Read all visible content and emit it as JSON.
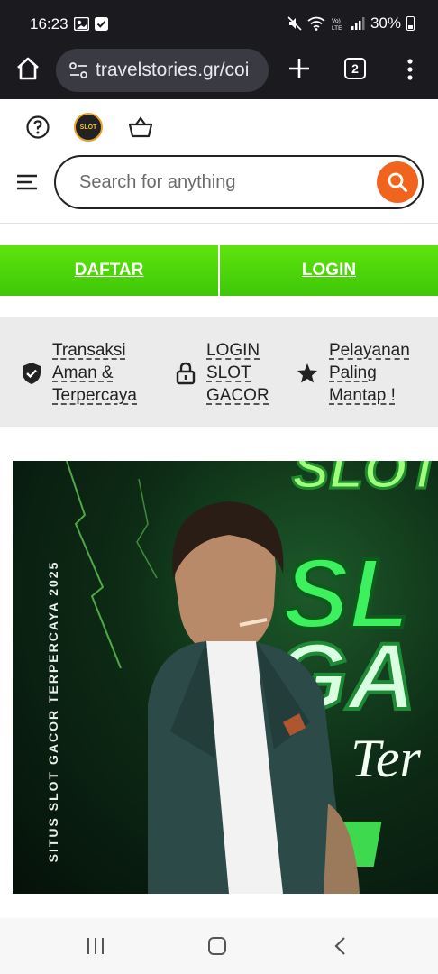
{
  "status_bar": {
    "time": "16:23",
    "battery": "30%",
    "left_icons": [
      "gallery-notification-icon",
      "check-notification-icon"
    ],
    "right_icons": [
      "mute-icon",
      "wifi-icon",
      "volte-icon",
      "signal-icon",
      "battery-icon"
    ]
  },
  "browser": {
    "url": "travelstories.gr/coi",
    "tab_count": "2",
    "icons": [
      "home-icon",
      "site-settings-icon",
      "new-tab-icon",
      "tab-switcher-icon",
      "more-menu-icon"
    ]
  },
  "site_header": {
    "logo_text": "SLOT",
    "search_placeholder": "Search for anything",
    "icons": [
      "help-icon",
      "basket-icon",
      "hamburger-menu-icon",
      "search-icon"
    ]
  },
  "auth": {
    "register_label": "DAFTAR",
    "login_label": "LOGIN"
  },
  "features": [
    {
      "icon": "shield-check-icon",
      "lines": [
        "Transaksi",
        "Aman &",
        "Terpercaya"
      ]
    },
    {
      "icon": "padlock-icon",
      "lines": [
        "LOGIN",
        "SLOT",
        "GACOR"
      ]
    },
    {
      "icon": "star-icon",
      "lines": [
        "Pelayanan",
        "Paling",
        "Mantap !"
      ]
    }
  ],
  "banner": {
    "side_text": "SITUS SLOT GACOR TERPERCAYA 2025",
    "title_top": "SLOT",
    "title_main": "SL",
    "title_second": "GA",
    "script_text": "Ter"
  },
  "colors": {
    "system_bar": "#1b1b1f",
    "accent_green": "#4fd60a",
    "search_orange": "#f1641e"
  }
}
